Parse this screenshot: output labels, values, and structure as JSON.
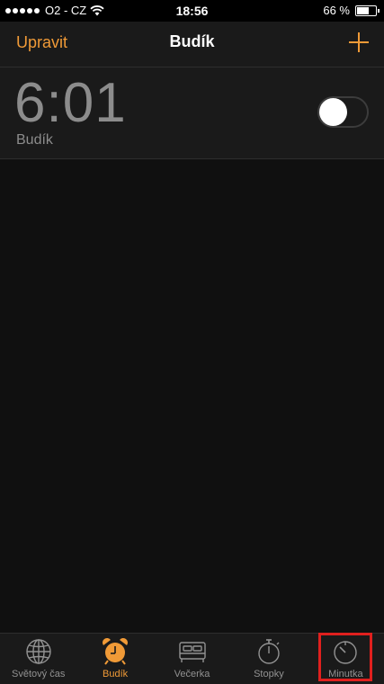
{
  "status_bar": {
    "carrier": "O2 - CZ",
    "time": "18:56",
    "battery_text": "66 %",
    "battery_level": 0.66,
    "signal_bars": 5
  },
  "nav": {
    "edit_label": "Upravit",
    "title": "Budík",
    "add_icon": "plus-icon"
  },
  "alarms": [
    {
      "time": "6:01",
      "label": "Budík",
      "enabled": false
    }
  ],
  "tabs": [
    {
      "id": "world-clock",
      "label": "Světový čas",
      "icon": "globe-icon",
      "active": false
    },
    {
      "id": "alarm",
      "label": "Budík",
      "icon": "alarm-clock-icon",
      "active": true
    },
    {
      "id": "bedtime",
      "label": "Večerka",
      "icon": "bed-icon",
      "active": false
    },
    {
      "id": "stopwatch",
      "label": "Stopky",
      "icon": "stopwatch-icon",
      "active": false
    },
    {
      "id": "timer",
      "label": "Minutka",
      "icon": "timer-icon",
      "active": false
    }
  ],
  "colors": {
    "accent": "#f09a37",
    "inactive": "#929292",
    "highlight": "#e0201e"
  }
}
